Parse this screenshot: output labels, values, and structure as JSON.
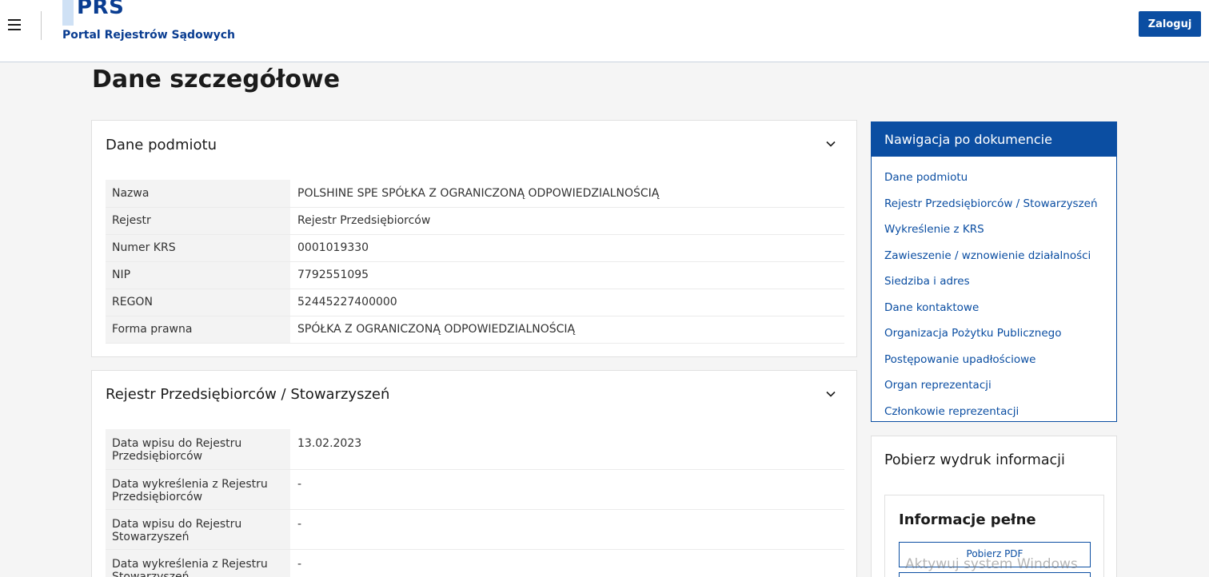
{
  "header": {
    "logo_title": "PRS",
    "logo_subtitle": "Portal Rejestrów Sądowych",
    "login_label": "Zaloguj"
  },
  "page_title": "Dane szczegółowe",
  "section_entity": {
    "title": "Dane podmiotu",
    "rows": [
      {
        "label": "Nazwa",
        "value": "POLSHINE SPE SPÓŁKA Z OGRANICZONĄ ODPOWIEDZIALNOŚCIĄ"
      },
      {
        "label": "Rejestr",
        "value": "Rejestr Przedsiębiorców"
      },
      {
        "label": "Numer KRS",
        "value": "0001019330"
      },
      {
        "label": "NIP",
        "value": "7792551095"
      },
      {
        "label": "REGON",
        "value": "52445227400000"
      },
      {
        "label": "Forma prawna",
        "value": "SPÓŁKA Z OGRANICZONĄ ODPOWIEDZIALNOŚCIĄ"
      }
    ]
  },
  "section_register": {
    "title": "Rejestr Przedsiębiorców / Stowarzyszeń",
    "rows": [
      {
        "label": "Data wpisu do Rejestru Przedsiębiorców",
        "value": "13.02.2023"
      },
      {
        "label": "Data wykreślenia z Rejestru Przedsiębiorców",
        "value": "-"
      },
      {
        "label": "Data wpisu do Rejestru Stowarzyszeń",
        "value": "-"
      },
      {
        "label": "Data wykreślenia z Rejestru Stowarzyszeń",
        "value": "-"
      }
    ]
  },
  "nav": {
    "title": "Nawigacja po dokumencie",
    "items": [
      "Dane podmiotu",
      "Rejestr Przedsiębiorców / Stowarzyszeń",
      "Wykreślenie z KRS",
      "Zawieszenie / wznowienie działalności",
      "Siedziba i adres",
      "Dane kontaktowe",
      "Organizacja Pożytku Publicznego",
      "Postępowanie upadłościowe",
      "Organ reprezentacji",
      "Członkowie reprezentacji"
    ]
  },
  "download": {
    "title": "Pobierz wydruk informacji",
    "box_title": "Informacje pełne",
    "pdf_label": "Pobierz PDF"
  },
  "watermark": "Aktywuj system Windows",
  "colors": {
    "primary": "#0b4ea2",
    "logo_accent": "#cfe1f5",
    "background": "#f5f5f5"
  },
  "icons": {
    "menu": "hamburger-menu-icon",
    "expand": "chevron-down-icon"
  }
}
